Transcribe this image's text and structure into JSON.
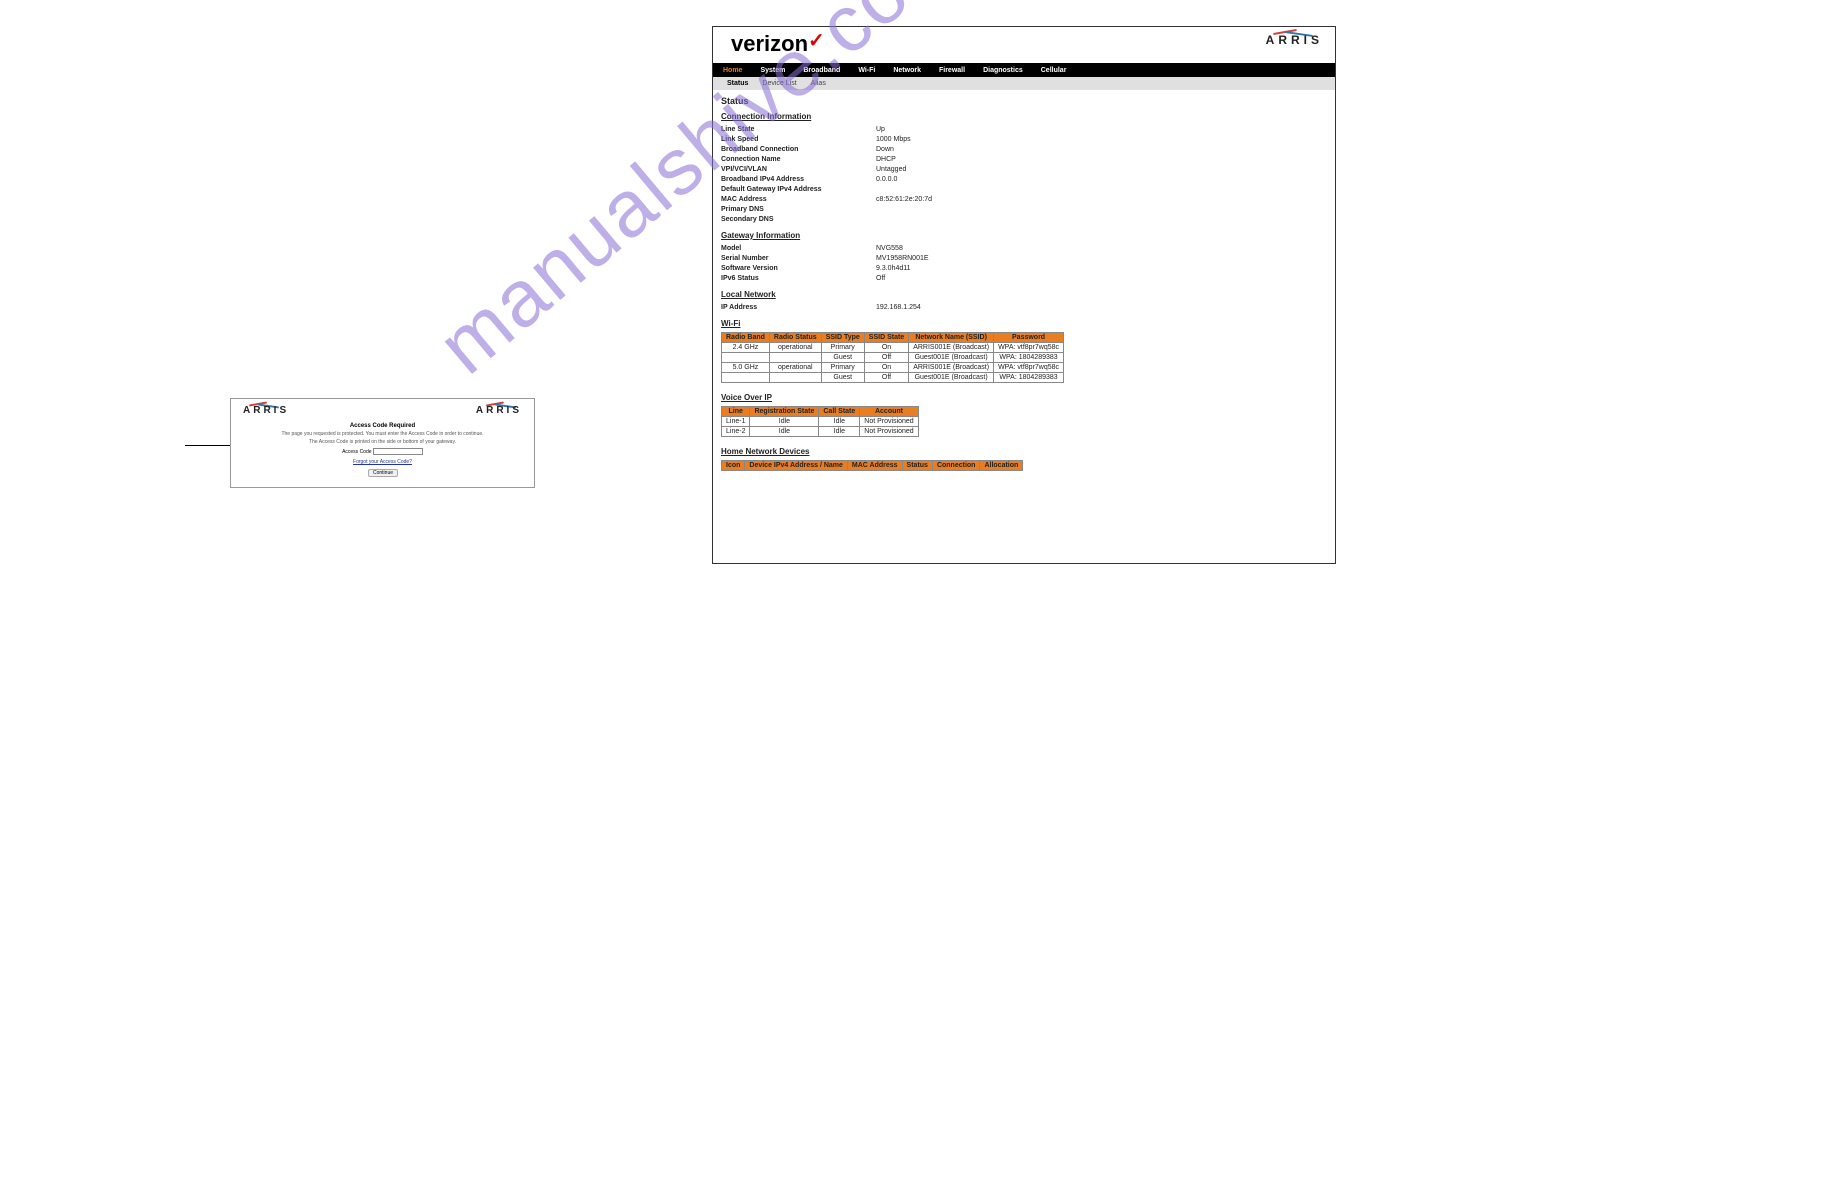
{
  "watermark": "manualshive.com",
  "arris_brand": "ARRIS",
  "left": {
    "title": "Access Code Required",
    "line1": "The page you requested is protected. You must enter the Access Code in order to continue.",
    "line2": "The Access Code is printed on the side or bottom of your gateway.",
    "input_label": "Access Code",
    "forgot": "Forgot your Access Code?",
    "continue": "Continue"
  },
  "right": {
    "nav": [
      "Home",
      "System",
      "Broadband",
      "Wi-Fi",
      "Network",
      "Firewall",
      "Diagnostics",
      "Cellular"
    ],
    "subnav": [
      "Status",
      "Device List",
      "Alias"
    ],
    "page_title": "Status",
    "conn_title": "Connection Information",
    "conn": [
      {
        "k": "Line State",
        "v": "Up"
      },
      {
        "k": "Link Speed",
        "v": "1000 Mbps"
      },
      {
        "k": "Broadband Connection",
        "v": "Down"
      },
      {
        "k": "Connection Name",
        "v": "DHCP"
      },
      {
        "k": "VPI/VCI/VLAN",
        "v": "Untagged"
      },
      {
        "k": "Broadband IPv4 Address",
        "v": "0.0.0.0"
      },
      {
        "k": "Default Gateway IPv4 Address",
        "v": ""
      },
      {
        "k": "MAC Address",
        "v": "c8:52:61:2e:20:7d"
      },
      {
        "k": "Primary DNS",
        "v": ""
      },
      {
        "k": "Secondary DNS",
        "v": ""
      }
    ],
    "gw_title": "Gateway Information",
    "gw": [
      {
        "k": "Model",
        "v": "NVG558"
      },
      {
        "k": "Serial Number",
        "v": "MV1958RN001E"
      },
      {
        "k": "Software Version",
        "v": "9.3.0h4d11"
      },
      {
        "k": "IPv6 Status",
        "v": "Off"
      }
    ],
    "ln_title": "Local Network",
    "ln": [
      {
        "k": "IP Address",
        "v": "192.168.1.254"
      }
    ],
    "wifi_title": "Wi-Fi",
    "wifi_headers": [
      "Radio Band",
      "Radio Status",
      "SSID Type",
      "SSID State",
      "Network Name (SSID)",
      "Password"
    ],
    "wifi_rows": [
      [
        "2.4 GHz",
        "operational",
        "Primary",
        "On",
        "ARRIS001E (Broadcast)",
        "WPA: vtf8pr7wq58c"
      ],
      [
        "",
        "",
        "Guest",
        "Off",
        "Guest001E (Broadcast)",
        "WPA: 1804289383"
      ],
      [
        "5.0 GHz",
        "operational",
        "Primary",
        "On",
        "ARRIS001E (Broadcast)",
        "WPA: vtf8pr7wq58c"
      ],
      [
        "",
        "",
        "Guest",
        "Off",
        "Guest001E (Broadcast)",
        "WPA: 1804289383"
      ]
    ],
    "voip_title": "Voice Over IP",
    "voip_headers": [
      "Line",
      "Registration State",
      "Call State",
      "Account"
    ],
    "voip_rows": [
      [
        "Line-1",
        "Idle",
        "Idle",
        "Not Provisioned"
      ],
      [
        "Line-2",
        "Idle",
        "Idle",
        "Not Provisioned"
      ]
    ],
    "hnd_title": "Home Network Devices",
    "hnd_headers": [
      "Icon",
      "Device IPv4 Address / Name",
      "MAC Address",
      "Status",
      "Connection",
      "Allocation"
    ]
  }
}
